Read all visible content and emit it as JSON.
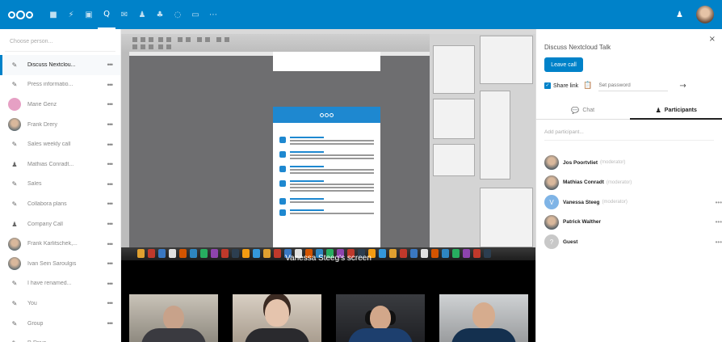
{
  "topbar": {
    "apps": [
      {
        "icon": "files-icon",
        "glyph": "■"
      },
      {
        "icon": "activity-icon",
        "glyph": "⚡"
      },
      {
        "icon": "gallery-icon",
        "glyph": "▣"
      },
      {
        "icon": "talk-icon",
        "glyph": "Q"
      },
      {
        "icon": "mail-icon",
        "glyph": "✉"
      },
      {
        "icon": "contacts-icon",
        "glyph": "♟"
      },
      {
        "icon": "circles-icon",
        "glyph": "♣"
      },
      {
        "icon": "tasks-icon",
        "glyph": "◌"
      },
      {
        "icon": "calendar-icon",
        "glyph": "▭"
      },
      {
        "icon": "more-icon",
        "glyph": "⋯"
      }
    ],
    "user_glyph": "♟"
  },
  "sidebar": {
    "search_placeholder": "Choose person...",
    "items": [
      {
        "label": "Discuss Nextclou...",
        "avatar": "pencil",
        "glyph": "✎",
        "active": true
      },
      {
        "label": "Press informatio...",
        "avatar": "pencil",
        "glyph": "✎"
      },
      {
        "label": "Marie Genz",
        "avatar": "pink"
      },
      {
        "label": "Frank Drery",
        "avatar": "photo"
      },
      {
        "label": "Sales weekly call",
        "avatar": "pencil",
        "glyph": "✎"
      },
      {
        "label": "Mathias Conradt...",
        "avatar": "group",
        "glyph": "♟"
      },
      {
        "label": "Sales",
        "avatar": "pencil",
        "glyph": "✎"
      },
      {
        "label": "Collabora plans",
        "avatar": "pencil",
        "glyph": "✎"
      },
      {
        "label": "Company Call",
        "avatar": "group",
        "glyph": "♟"
      },
      {
        "label": "Frank Karlitschek,...",
        "avatar": "photo"
      },
      {
        "label": "Ivan Sein Saroulgis",
        "avatar": "photo"
      },
      {
        "label": "I have renamed...",
        "avatar": "pencil",
        "glyph": "✎"
      },
      {
        "label": "You",
        "avatar": "pencil",
        "glyph": "✎"
      },
      {
        "label": "Group",
        "avatar": "pencil",
        "glyph": "✎"
      },
      {
        "label": "P-Drive",
        "avatar": "pencil",
        "glyph": "✎"
      }
    ],
    "more_glyph": "•••"
  },
  "center": {
    "screen_caption": "Vanessa Steeg's screen"
  },
  "panel": {
    "title": "Discuss Nextcloud Talk",
    "leave_label": "Leave call",
    "share_label": "Share link",
    "password_placeholder": "Set password",
    "tabs": {
      "chat": "Chat",
      "participants": "Participants"
    },
    "add_placeholder": "Add participant...",
    "participants": [
      {
        "name": "Jos Poortvliet",
        "role": "(moderator)",
        "avatar": "photo"
      },
      {
        "name": "Mathias Conradt",
        "role": "(moderator)",
        "avatar": "photo"
      },
      {
        "name": "Vanessa Steeg",
        "role": "(moderator)",
        "avatar": "letter",
        "letter": "V",
        "color": "#7fb4e6"
      },
      {
        "name": "Patrick Walther",
        "role": "",
        "avatar": "photo"
      },
      {
        "name": "Guest",
        "role": "",
        "avatar": "letter",
        "letter": "?",
        "color": "#c8c8c8"
      }
    ]
  },
  "colors": {
    "accent": "#0082c9"
  }
}
